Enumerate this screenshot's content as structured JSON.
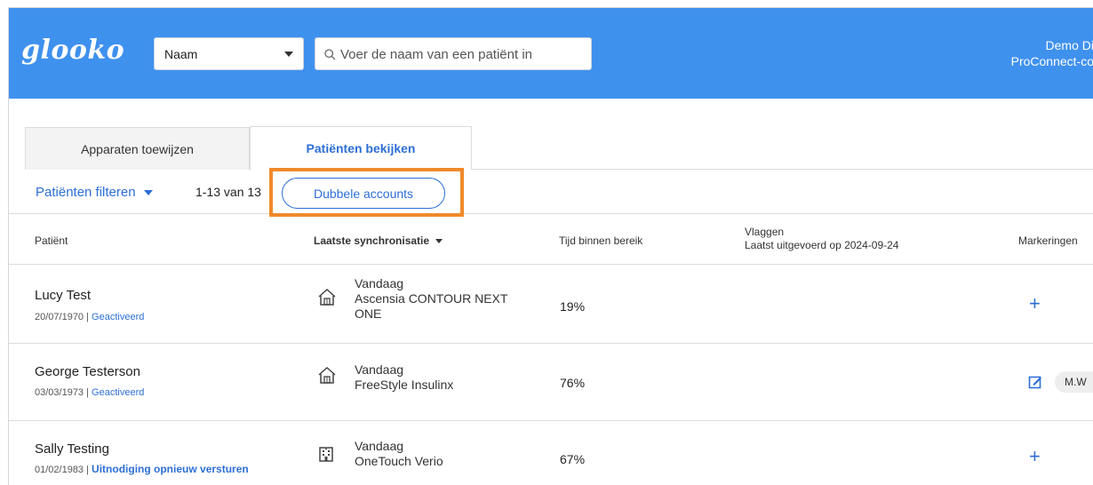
{
  "header": {
    "logo": "glooko",
    "search_type": "Naam",
    "search_placeholder": "Voer de naam van een patiënt in",
    "user_line1": "Demo Di",
    "user_line2": "ProConnect-co"
  },
  "tabs": [
    {
      "label": "Apparaten toewijzen",
      "active": false
    },
    {
      "label": "Patiënten bekijken",
      "active": true
    }
  ],
  "toolbar": {
    "filter_label": "Patiënten filteren",
    "count": "1-13 van 13",
    "duplicate_label": "Dubbele accounts",
    "highlight_color": "#f08a2b"
  },
  "table": {
    "headers": {
      "patient": "Patiënt",
      "last_sync": "Laatste synchronisatie",
      "tir": "Tijd binnen bereik",
      "flags": "Vlaggen",
      "flags_sub": "Laatst uitgevoerd op 2024-09-24",
      "markings": "Markeringen"
    },
    "rows": [
      {
        "name": "Lucy Test",
        "dob": "20/07/1970",
        "status": "Geactiveerd",
        "device_icon": "home-icon",
        "sync_when": "Vandaag",
        "device_line1": "Ascensia CONTOUR NEXT",
        "device_line2": "ONE",
        "tir": "19%",
        "marking": "add"
      },
      {
        "name": "George Testerson",
        "dob": "03/03/1973",
        "status": "Geactiveerd",
        "device_icon": "home-icon",
        "sync_when": "Vandaag",
        "device_line1": "FreeStyle Insulinx",
        "tir": "76%",
        "marking": "edit",
        "marking_chip": "M.W"
      },
      {
        "name": "Sally Testing",
        "dob": "01/02/1983",
        "status": "Uitnodiging opnieuw versturen",
        "device_icon": "clinic-icon",
        "sync_when": "Vandaag",
        "device_line1": "OneTouch Verio",
        "tir": "67%",
        "marking": "add"
      }
    ]
  },
  "colors": {
    "header_bg": "#3f91ee",
    "accent": "#2d6fd6"
  }
}
